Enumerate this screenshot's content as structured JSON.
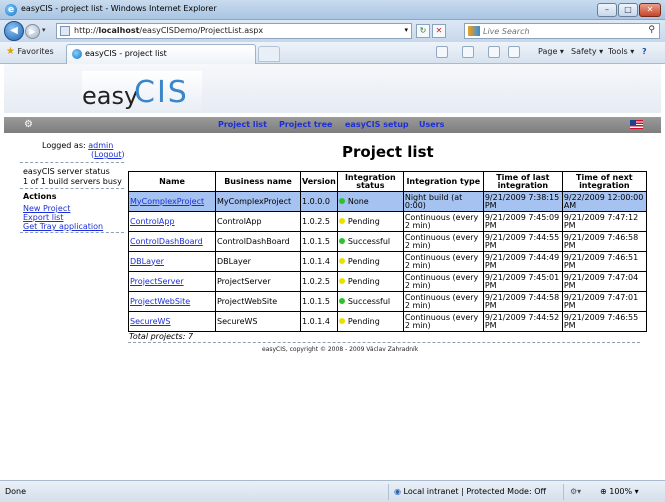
{
  "window": {
    "title": "easyCIS - project list - Windows Internet Explorer",
    "min_glyph": "–",
    "max_glyph": "□",
    "close_glyph": "✕"
  },
  "addressbar": {
    "url_prefix": "http://",
    "url_host": "localhost",
    "url_path": "/easyCISDemo/ProjectList.aspx",
    "search_placeholder": "Live Search"
  },
  "tabbar": {
    "favorites_label": "Favorites",
    "tab_title": "easyCIS - project list",
    "page_menu": "Page ▾",
    "safety_menu": "Safety ▾",
    "tools_menu": "Tools ▾",
    "help_glyph": "?"
  },
  "site": {
    "logo_easy": "easy",
    "logo_cis": "CIS",
    "menu": [
      "Project list",
      "Project tree",
      "easyCIS setup",
      "Users"
    ]
  },
  "sidebar": {
    "logged_as": "Logged as: ",
    "user": "admin",
    "logout_open": "(",
    "logout": "Logout",
    "logout_close": ")",
    "server_status_line1": "easyCIS server status",
    "server_status_line2": "1 of 1 build servers busy",
    "actions_title": "Actions",
    "actions": [
      "New Project",
      "Export list",
      "Get Tray application"
    ]
  },
  "main": {
    "title": "Project list",
    "columns": [
      "Name",
      "Business name",
      "Version",
      "Integration status",
      "Integration type",
      "Time of last integration",
      "Time of next integration"
    ],
    "rows": [
      {
        "name": "MyComplexProject",
        "business": "MyComplexProject",
        "version": "1.0.0.0",
        "status": "None",
        "status_color": "#2fc02f",
        "type": "Night build (at 0:00)",
        "last": "9/21/2009 7:38:15 PM",
        "next": "9/22/2009 12:00:00 AM"
      },
      {
        "name": "ControlApp",
        "business": "ControlApp",
        "version": "1.0.2.5",
        "status": "Pending",
        "status_color": "#e8e000",
        "type": "Continuous (every 2 min)",
        "last": "9/21/2009 7:45:09 PM",
        "next": "9/21/2009 7:47:12 PM"
      },
      {
        "name": "ControlDashBoard",
        "business": "ControlDashBoard",
        "version": "1.0.1.5",
        "status": "Successful",
        "status_color": "#2fc02f",
        "type": "Continuous (every 2 min)",
        "last": "9/21/2009 7:44:55 PM",
        "next": "9/21/2009 7:46:58 PM"
      },
      {
        "name": "DBLayer",
        "business": "DBLayer",
        "version": "1.0.1.4",
        "status": "Pending",
        "status_color": "#e8e000",
        "type": "Continuous (every 2 min)",
        "last": "9/21/2009 7:44:49 PM",
        "next": "9/21/2009 7:46:51 PM"
      },
      {
        "name": "ProjectServer",
        "business": "ProjectServer",
        "version": "1.0.2.5",
        "status": "Pending",
        "status_color": "#e8e000",
        "type": "Continuous (every 2 min)",
        "last": "9/21/2009 7:45:01 PM",
        "next": "9/21/2009 7:47:04 PM"
      },
      {
        "name": "ProjectWebSite",
        "business": "ProjectWebSite",
        "version": "1.0.1.5",
        "status": "Successful",
        "status_color": "#2fc02f",
        "type": "Continuous (every 2 min)",
        "last": "9/21/2009 7:44:58 PM",
        "next": "9/21/2009 7:47:01 PM"
      },
      {
        "name": "SecureWS",
        "business": "SecureWS",
        "version": "1.0.1.4",
        "status": "Pending",
        "status_color": "#e8e000",
        "type": "Continuous (every 2 min)",
        "last": "9/21/2009 7:44:52 PM",
        "next": "9/21/2009 7:46:55 PM"
      }
    ],
    "total": "Total projects: 7",
    "copyright": "easyCIS, copyright © 2008 - 2009 Václav Zahradník"
  },
  "statusbar": {
    "done": "Done",
    "zone": "Local intranet | Protected Mode: Off",
    "zoom": "100%"
  }
}
